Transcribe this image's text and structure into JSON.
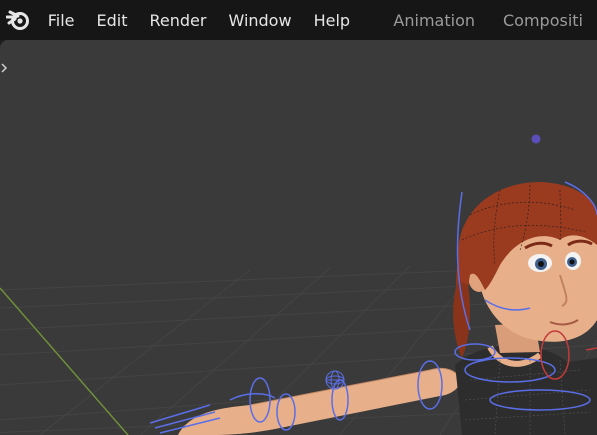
{
  "app": {
    "logo_icon": "blender-logo-icon"
  },
  "menu": {
    "items": [
      "File",
      "Edit",
      "Render",
      "Window",
      "Help"
    ]
  },
  "workspaces": {
    "tabs": [
      "Animation",
      "Compositi"
    ]
  },
  "viewport": {
    "toolbar_toggle_icon": "chevron-right-icon",
    "scene_object": "rigged-cartoon-character",
    "colors": {
      "background": "#3a3a3a",
      "grid": "#444444",
      "y_axis": "#6f8f3a",
      "rig_control": "#5a6ee6",
      "rig_control_red": "#c23b3b",
      "skin": "#e8b08a",
      "hair": "#9a3a1f",
      "shirt": "#2d2d2d"
    }
  }
}
